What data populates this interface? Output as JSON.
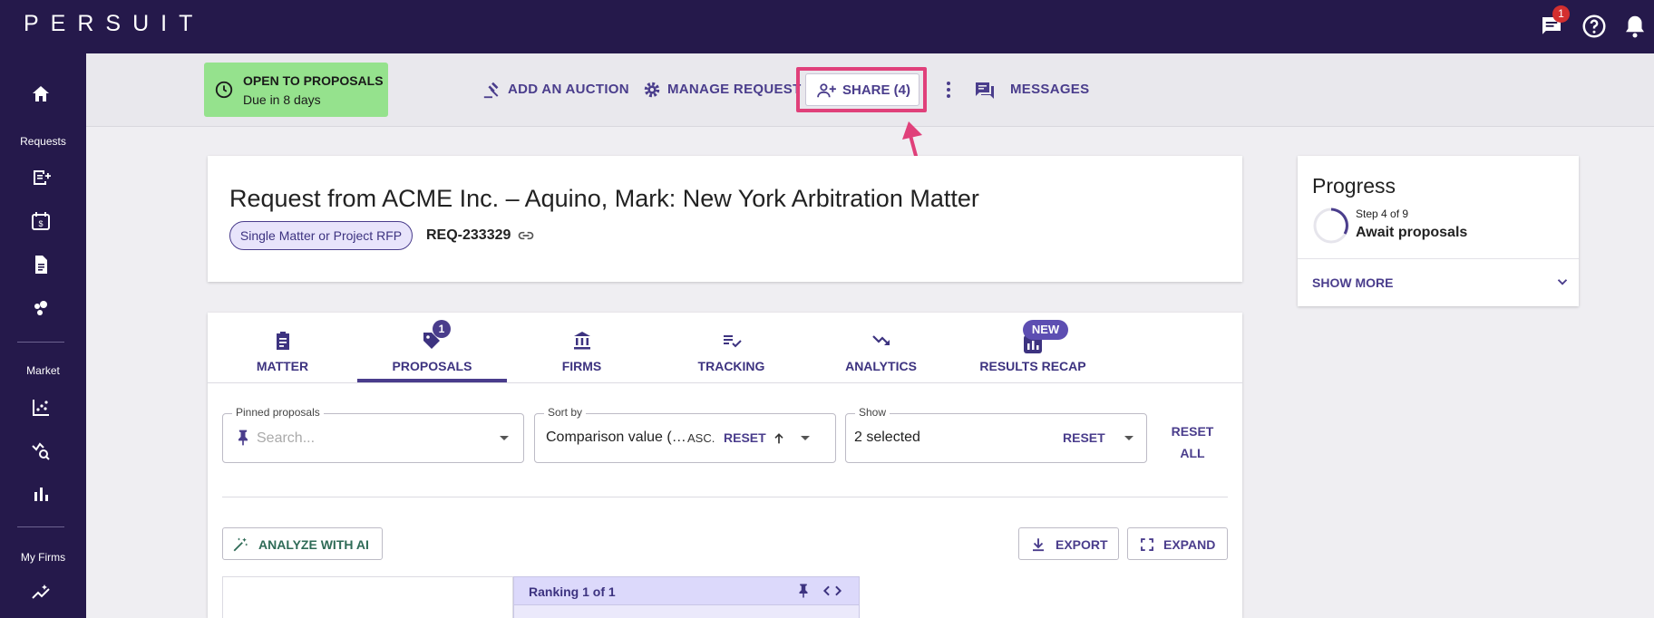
{
  "app": {
    "logo": "PERSUIT",
    "notification_count": "1"
  },
  "sidebar": {
    "sections": [
      {
        "label": "Requests"
      },
      {
        "label": "Market"
      },
      {
        "label": "My Firms"
      }
    ]
  },
  "status": {
    "title": "OPEN TO PROPOSALS",
    "due": "Due in 8 days"
  },
  "actions": {
    "add_auction": "ADD AN AUCTION",
    "manage_request": "MANAGE REQUEST",
    "share": "SHARE (4)",
    "messages": "MESSAGES"
  },
  "request": {
    "title": "Request from ACME Inc. – Aquino, Mark: New York Arbitration Matter",
    "type": "Single Matter or Project RFP",
    "id": "REQ-233329"
  },
  "progress": {
    "title": "Progress",
    "step": "Step 4 of 9",
    "step_name": "Await proposals",
    "show_more": "SHOW MORE"
  },
  "tabs": [
    {
      "label": "MATTER"
    },
    {
      "label": "PROPOSALS",
      "badge": "1",
      "active": true
    },
    {
      "label": "FIRMS"
    },
    {
      "label": "TRACKING"
    },
    {
      "label": "ANALYTICS"
    },
    {
      "label": "RESULTS RECAP",
      "badge": "NEW"
    }
  ],
  "filters": {
    "pinned": {
      "label": "Pinned proposals",
      "placeholder": "Search..."
    },
    "sort": {
      "label": "Sort by",
      "value": "Comparison value (…",
      "direction": "ASC.",
      "reset": "RESET"
    },
    "show": {
      "label": "Show",
      "value": "2 selected",
      "reset": "RESET"
    },
    "reset_all": "RESET ALL"
  },
  "toolbar": {
    "analyze": "ANALYZE WITH AI",
    "export": "EXPORT",
    "expand": "EXPAND"
  },
  "table": {
    "ranking": "Ranking 1 of 1"
  },
  "colors": {
    "brand_dark": "#25194b",
    "accent": "#4a3d8c",
    "status_green": "#95e28d",
    "highlight": "#e0407a"
  }
}
